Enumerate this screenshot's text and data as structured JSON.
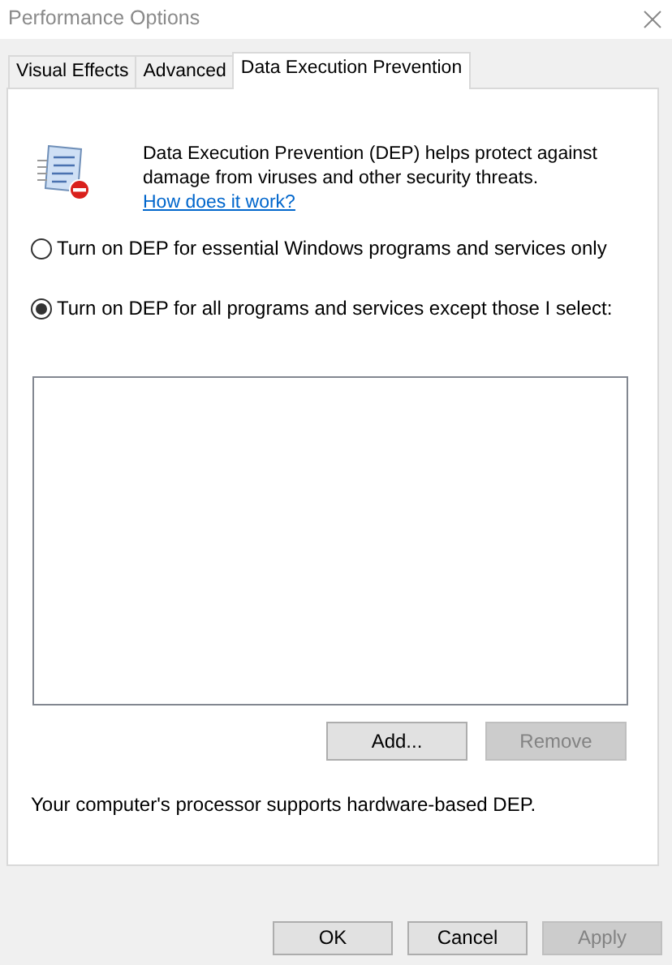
{
  "window": {
    "title": "Performance Options"
  },
  "tabs": [
    {
      "label": "Visual Effects",
      "selected": false
    },
    {
      "label": "Advanced",
      "selected": false
    },
    {
      "label": "Data Execution Prevention",
      "selected": true
    }
  ],
  "description": {
    "text": "Data Execution Prevention (DEP) helps protect against damage from viruses and other security threats.",
    "link": "How does it work?"
  },
  "options": [
    {
      "label": "Turn on DEP for essential Windows programs and services only",
      "selected": false
    },
    {
      "label": "Turn on DEP for all programs and services except those I select:",
      "selected": true
    }
  ],
  "list_buttons": [
    {
      "label": "Add...",
      "disabled": false
    },
    {
      "label": "Remove",
      "disabled": true
    }
  ],
  "support_text": "Your computer's processor supports hardware-based DEP.",
  "dialog_buttons": [
    {
      "label": "OK",
      "disabled": false
    },
    {
      "label": "Cancel",
      "disabled": false
    },
    {
      "label": "Apply",
      "disabled": true
    }
  ]
}
